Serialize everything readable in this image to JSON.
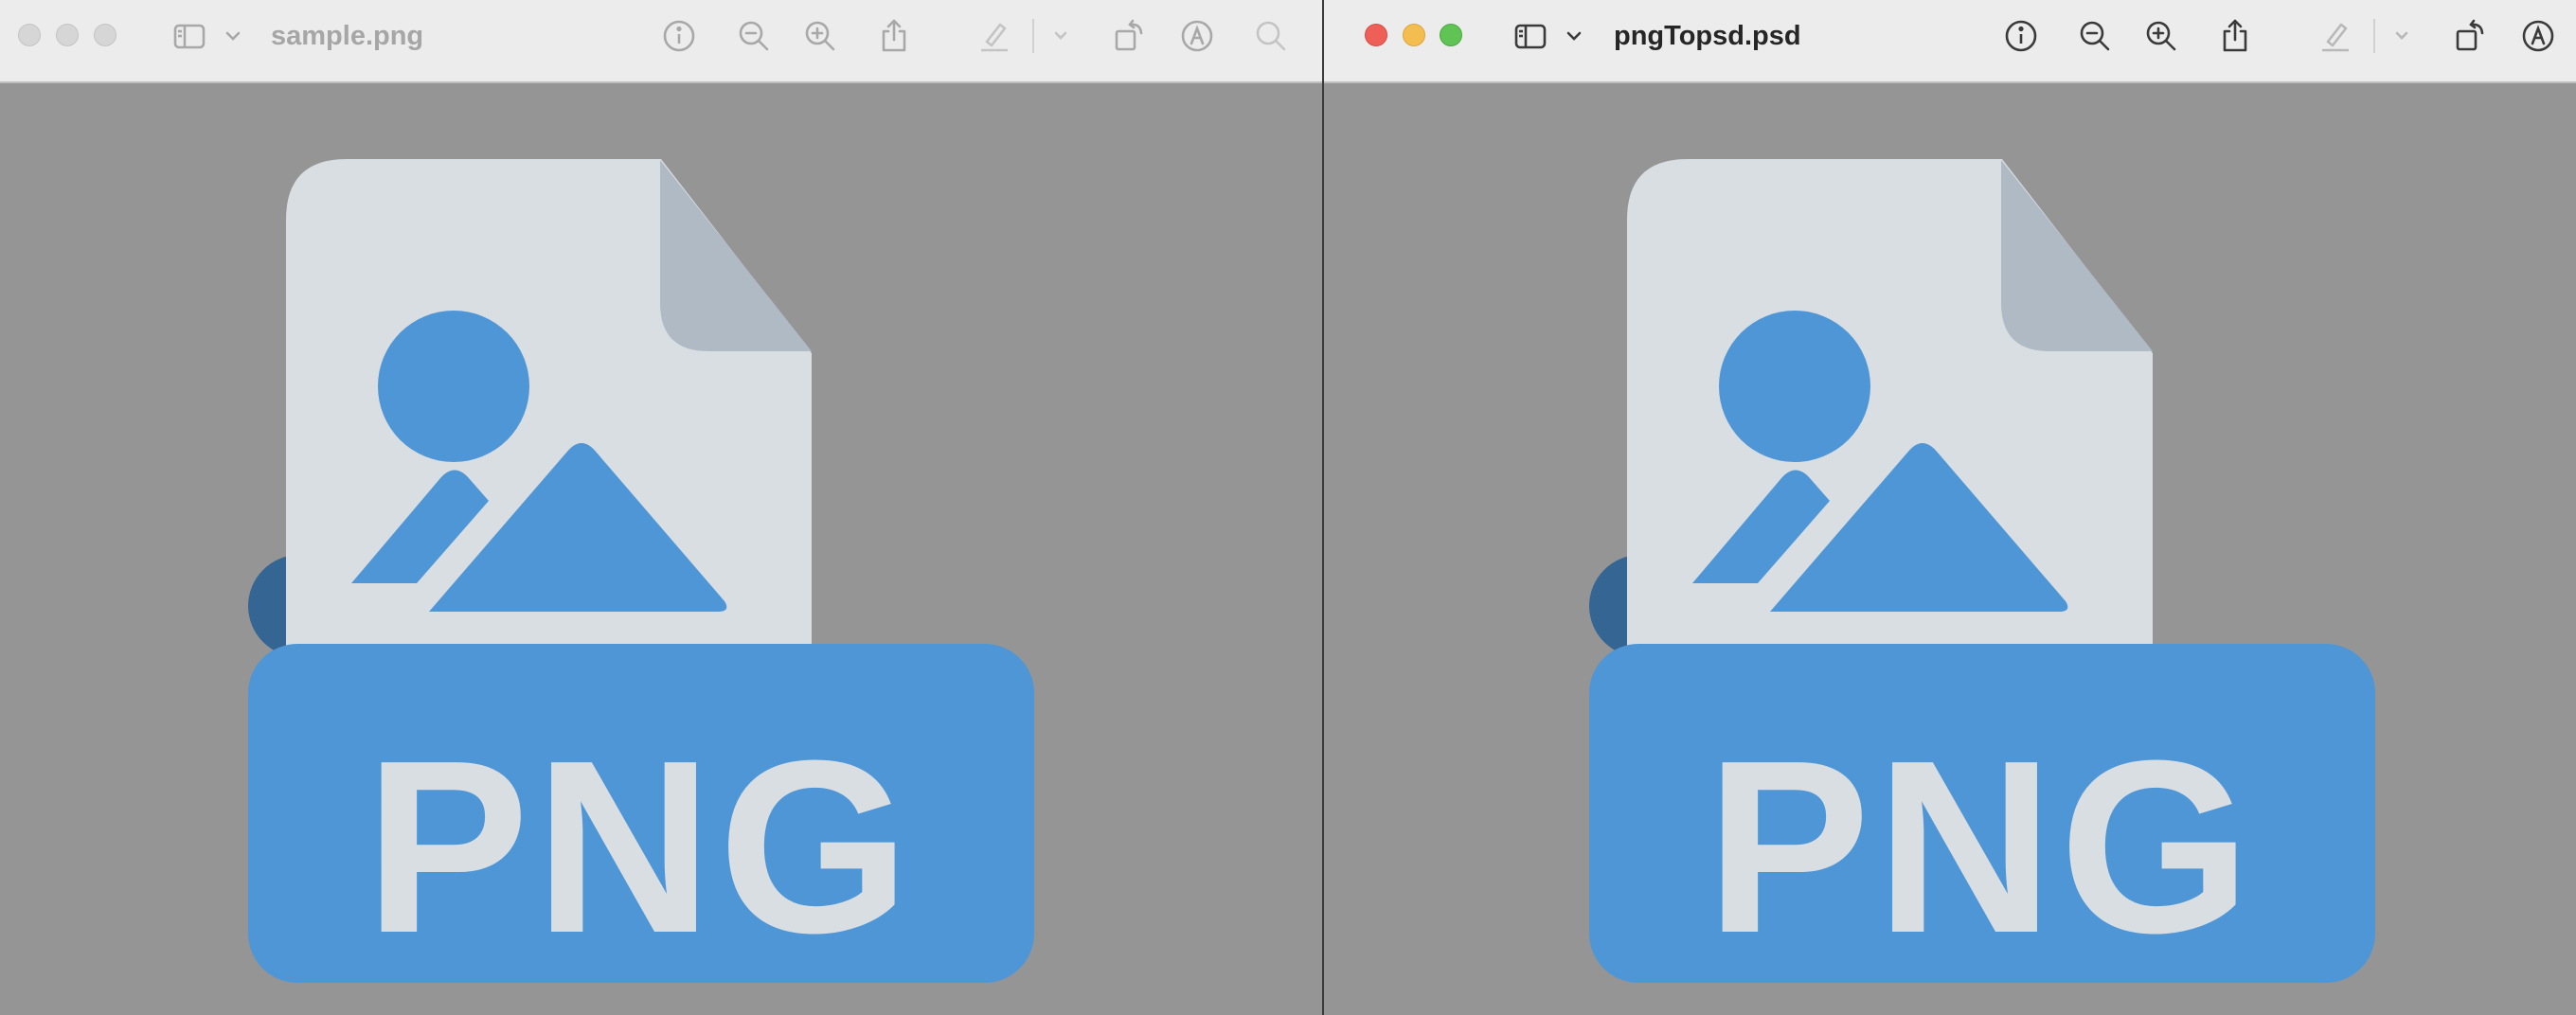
{
  "windows": [
    {
      "id": "left",
      "active": false,
      "title": "sample.png",
      "toolbar": [
        "sidebar-icon",
        "chevron-down-icon",
        "info-icon",
        "zoom-out-icon",
        "zoom-in-icon",
        "share-icon",
        "markup-pen-icon",
        "chevron-down-icon",
        "rotate-icon",
        "markup-icon",
        "search-icon"
      ],
      "document": {
        "label": "PNG"
      }
    },
    {
      "id": "right",
      "active": true,
      "title": "pngTopsd.psd",
      "toolbar": [
        "sidebar-icon",
        "chevron-down-icon",
        "info-icon",
        "zoom-out-icon",
        "zoom-in-icon",
        "share-icon",
        "markup-pen-icon",
        "chevron-down-icon",
        "rotate-icon",
        "markup-icon"
      ],
      "document": {
        "label": "PNG"
      }
    }
  ],
  "colors": {
    "canvas_bg": "#959595",
    "titlebar_bg": "#ececec",
    "page": "#d9dee3",
    "page_fold": "#b0bac4",
    "accent_blue": "#4f96d6",
    "dark_blue": "#356592",
    "traffic_red": "#ed5f57",
    "traffic_yellow": "#f4bd4f",
    "traffic_green": "#5fc454"
  }
}
